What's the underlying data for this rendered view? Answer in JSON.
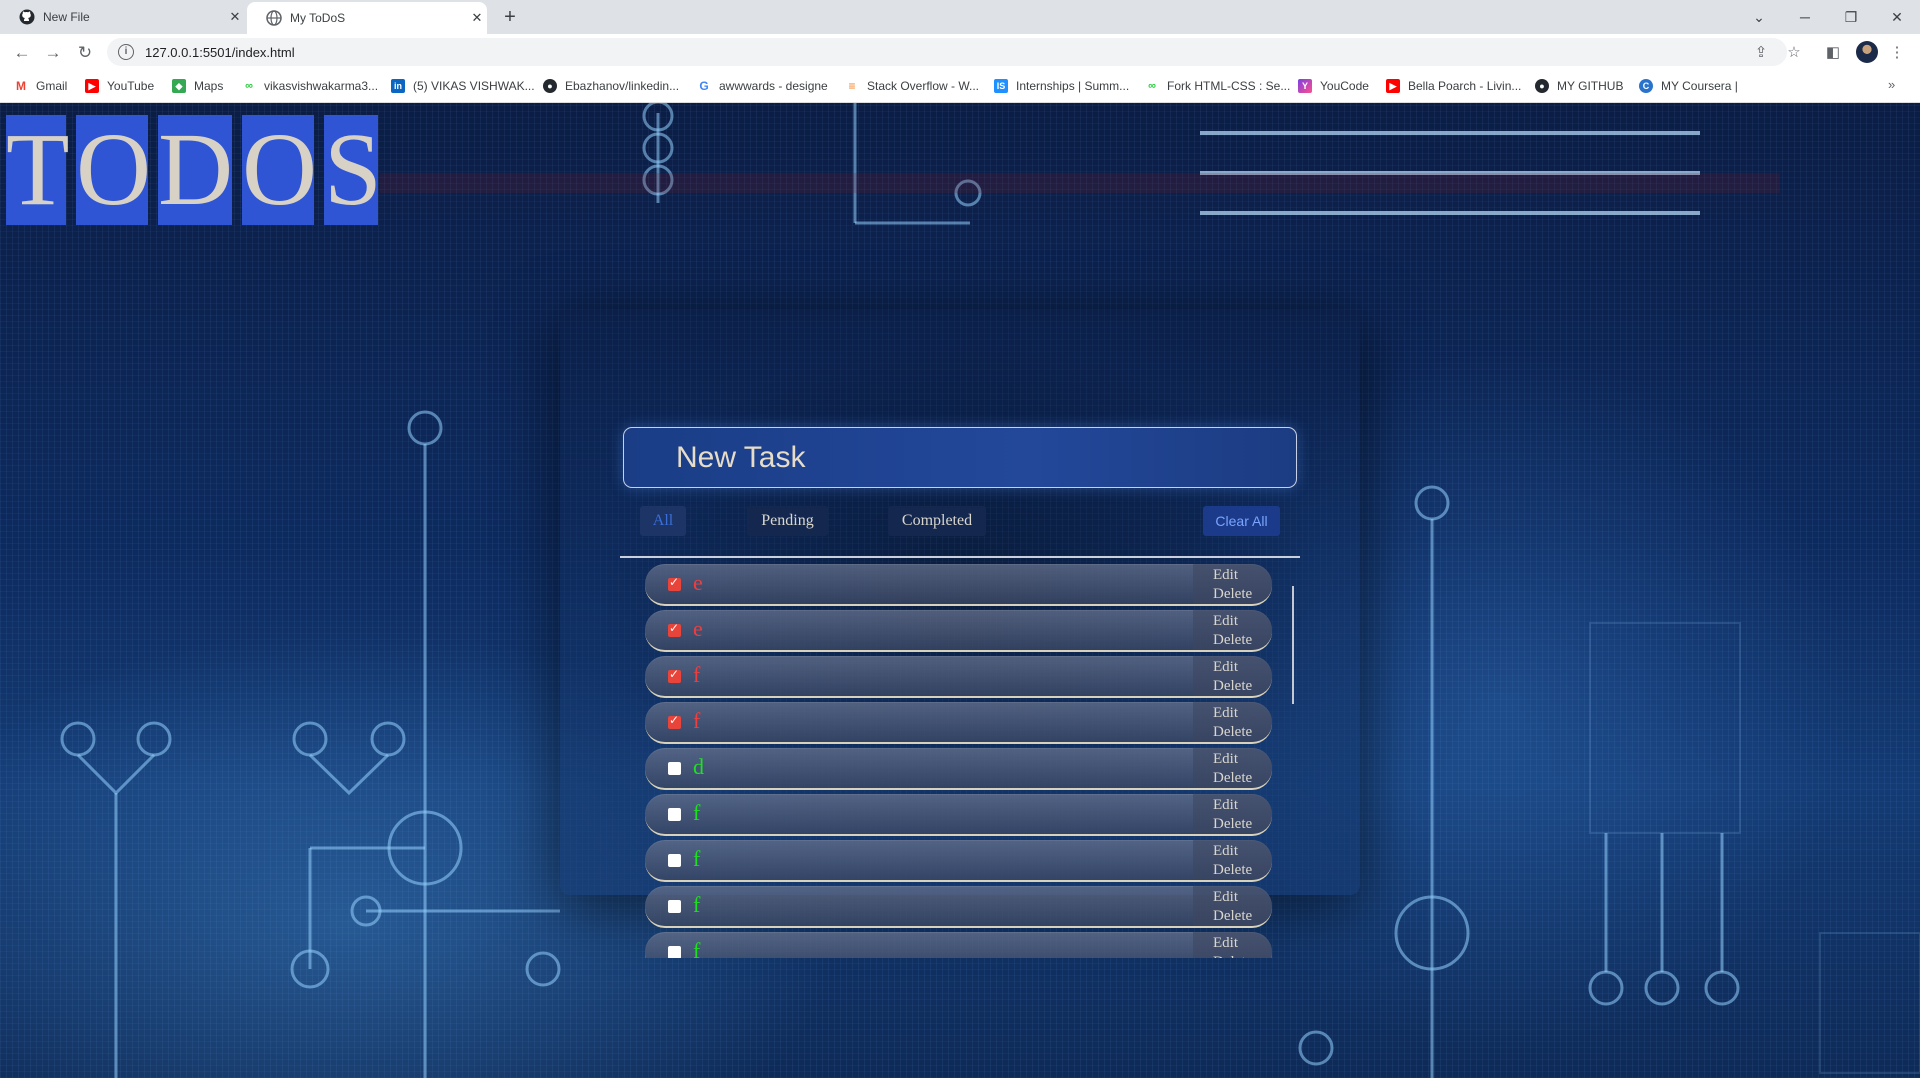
{
  "browser": {
    "tabs": [
      {
        "title": "New File",
        "active": false
      },
      {
        "title": "My ToDoS",
        "active": true
      }
    ],
    "url": "127.0.0.1:5501/index.html",
    "bookmarks": [
      {
        "label": "Gmail",
        "icon": "gmail-icon"
      },
      {
        "label": "YouTube",
        "icon": "youtube-icon"
      },
      {
        "label": "Maps",
        "icon": "maps-icon"
      },
      {
        "label": "vikasvishwakarma3...",
        "icon": "codepen-icon"
      },
      {
        "label": "(5) VIKAS VISHWAK...",
        "icon": "linkedin-icon"
      },
      {
        "label": "Ebazhanov/linkedin...",
        "icon": "github-icon"
      },
      {
        "label": "awwwards - designe",
        "icon": "google-icon"
      },
      {
        "label": "Stack Overflow - W...",
        "icon": "stackoverflow-icon"
      },
      {
        "label": "Internships | Summ...",
        "icon": "internshala-icon"
      },
      {
        "label": "Fork HTML-CSS : Se...",
        "icon": "codepen-icon"
      },
      {
        "label": "YouCode",
        "icon": "youcode-icon"
      },
      {
        "label": "Bella Poarch - Livin...",
        "icon": "youtube-icon"
      },
      {
        "label": "MY GITHUB",
        "icon": "github-icon"
      },
      {
        "label": "MY Coursera |",
        "icon": "coursera-icon"
      }
    ]
  },
  "app": {
    "logo_letters": [
      "T",
      "O",
      "D",
      "O",
      "S"
    ],
    "new_task_placeholder": "New Task",
    "filters": {
      "all": "All",
      "pending": "Pending",
      "completed": "Completed"
    },
    "clear_all": "Clear All",
    "edit_label": "Edit",
    "delete_label": "Delete",
    "tasks": [
      {
        "text": "e",
        "completed": true
      },
      {
        "text": "e",
        "completed": true
      },
      {
        "text": "f",
        "completed": true
      },
      {
        "text": "f",
        "completed": true
      },
      {
        "text": "d",
        "completed": false
      },
      {
        "text": "f",
        "completed": false
      },
      {
        "text": "f",
        "completed": false
      },
      {
        "text": "f",
        "completed": false
      },
      {
        "text": "f",
        "completed": false
      }
    ]
  },
  "colors": {
    "completed_text": "#ef3e3e",
    "pending_text": "#1fe01f",
    "logo_tile": "#2f55d4",
    "accent": "#3a6ed8"
  }
}
